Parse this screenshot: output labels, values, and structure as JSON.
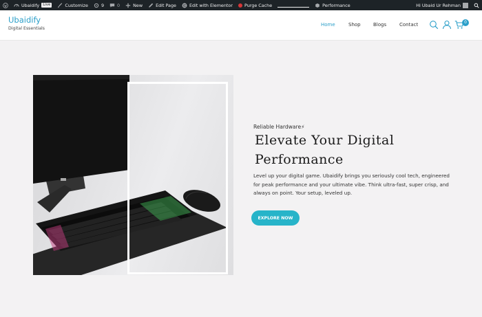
{
  "admin_bar": {
    "site_name": "Ubaidify",
    "live_badge": "Live",
    "customize": "Customize",
    "updates_count": "9",
    "comments_count": "0",
    "new": "New",
    "edit_page": "Edit Page",
    "edit_elementor": "Edit with Elementor",
    "purge_cache": "Purge Cache",
    "performance": "Performance",
    "greeting": "Hi Ubaid Ur Rehman"
  },
  "header": {
    "brand_title": "Ubaidify",
    "brand_subtitle": "Digital Essentials",
    "nav": [
      "Home",
      "Shop",
      "Blogs",
      "Contact"
    ],
    "active_nav": "Home",
    "cart_count": "0"
  },
  "hero": {
    "tagline": "Reliable Hardware⚡",
    "headline_line1": "Elevate Your Digital",
    "headline_line2": "Performance",
    "body": "Level up your digital game. Ubaidify brings you seriously cool tech, engineered for peak performance and your ultimate vibe. Think ultra-fast, super crisp, and always on point. Your setup, leveled up.",
    "cta": "EXPLORE NOW"
  },
  "colors": {
    "accent": "#2b9fc9",
    "cta": "#27b4c9",
    "admin_bar": "#1d2327",
    "page_bg": "#f3f2f3"
  }
}
